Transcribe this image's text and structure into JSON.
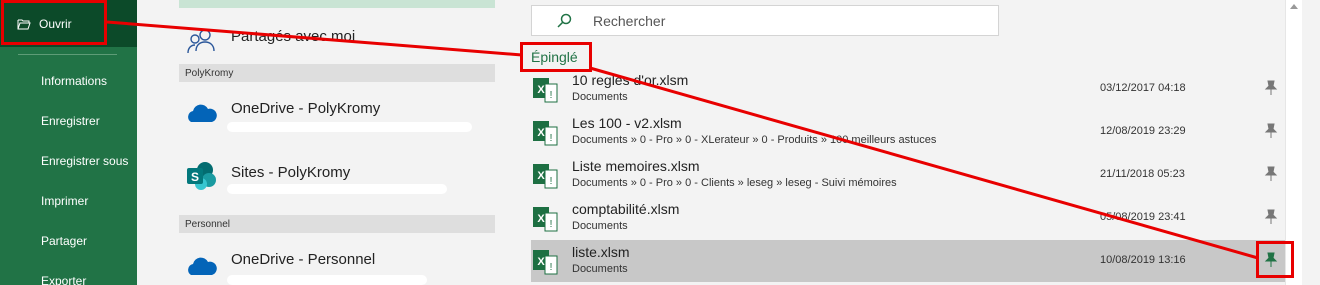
{
  "nav": {
    "open_label": "Ouvrir",
    "items": [
      "Informations",
      "Enregistrer",
      "Enregistrer sous",
      "Imprimer",
      "Partager",
      "Exporter"
    ]
  },
  "locations": {
    "shared": "Partagés avec moi",
    "section_polykromy": "PolyKromy",
    "onedrive_poly": "OneDrive - PolyKromy",
    "sites_poly": "Sites - PolyKromy",
    "section_personnel": "Personnel",
    "onedrive_perso": "OneDrive - Personnel"
  },
  "search": {
    "placeholder": "Rechercher"
  },
  "pinned_header": "Épinglé",
  "files": [
    {
      "name": "10 regles d'or.xlsm",
      "path": "Documents",
      "date": "03/12/2017 04:18"
    },
    {
      "name": "Les 100 - v2.xlsm",
      "path": "Documents » 0 - Pro » 0 - XLerateur » 0 - Produits » 100 meilleurs astuces",
      "date": "12/08/2019 23:29"
    },
    {
      "name": "Liste memoires.xlsm",
      "path": "Documents » 0 - Pro » 0 - Clients » leseg » leseg - Suivi mémoires",
      "date": "21/11/2018 05:23"
    },
    {
      "name": "comptabilité.xlsm",
      "path": "Documents",
      "date": "05/08/2019 23:41"
    },
    {
      "name": "liste.xlsm",
      "path": "Documents",
      "date": "10/08/2019 13:16"
    }
  ],
  "colors": {
    "nav_green": "#217346",
    "nav_selected": "#0c4a29",
    "annotation_red": "#e80000",
    "pinned_green": "#217346"
  }
}
